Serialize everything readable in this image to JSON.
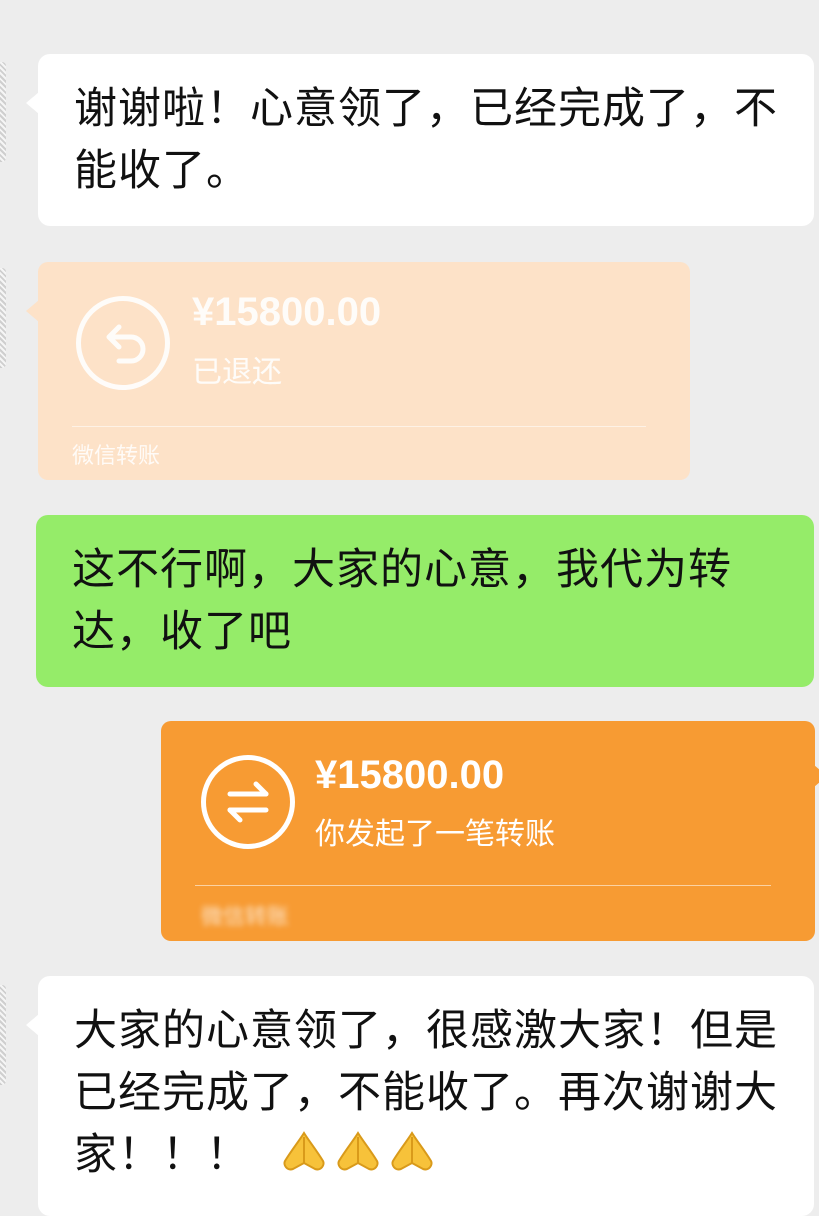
{
  "messages": {
    "msg1": {
      "text": "谢谢啦！心意领了，已经完成了，不能收了。"
    },
    "transfer1": {
      "amount": "¥15800.00",
      "status": "已退还",
      "footer": "微信转账",
      "icon": "return-arrow-icon",
      "color": "#fde2c8"
    },
    "msg2": {
      "text": "这不行啊，大家的心意，我代为转达，收了吧"
    },
    "transfer2": {
      "amount": "¥15800.00",
      "status": "你发起了一笔转账",
      "footer": "微信转账",
      "icon": "transfer-arrows-icon",
      "color": "#f79b33"
    },
    "msg3": {
      "text": "大家的心意领了，很感激大家！但是已经完成了，不能收了。再次谢谢大家！！！",
      "emoji": [
        "pray-icon",
        "pray-icon",
        "pray-icon"
      ]
    }
  },
  "colors": {
    "background": "#ededed",
    "incoming_bubble": "#ffffff",
    "outgoing_bubble": "#95ec69"
  }
}
